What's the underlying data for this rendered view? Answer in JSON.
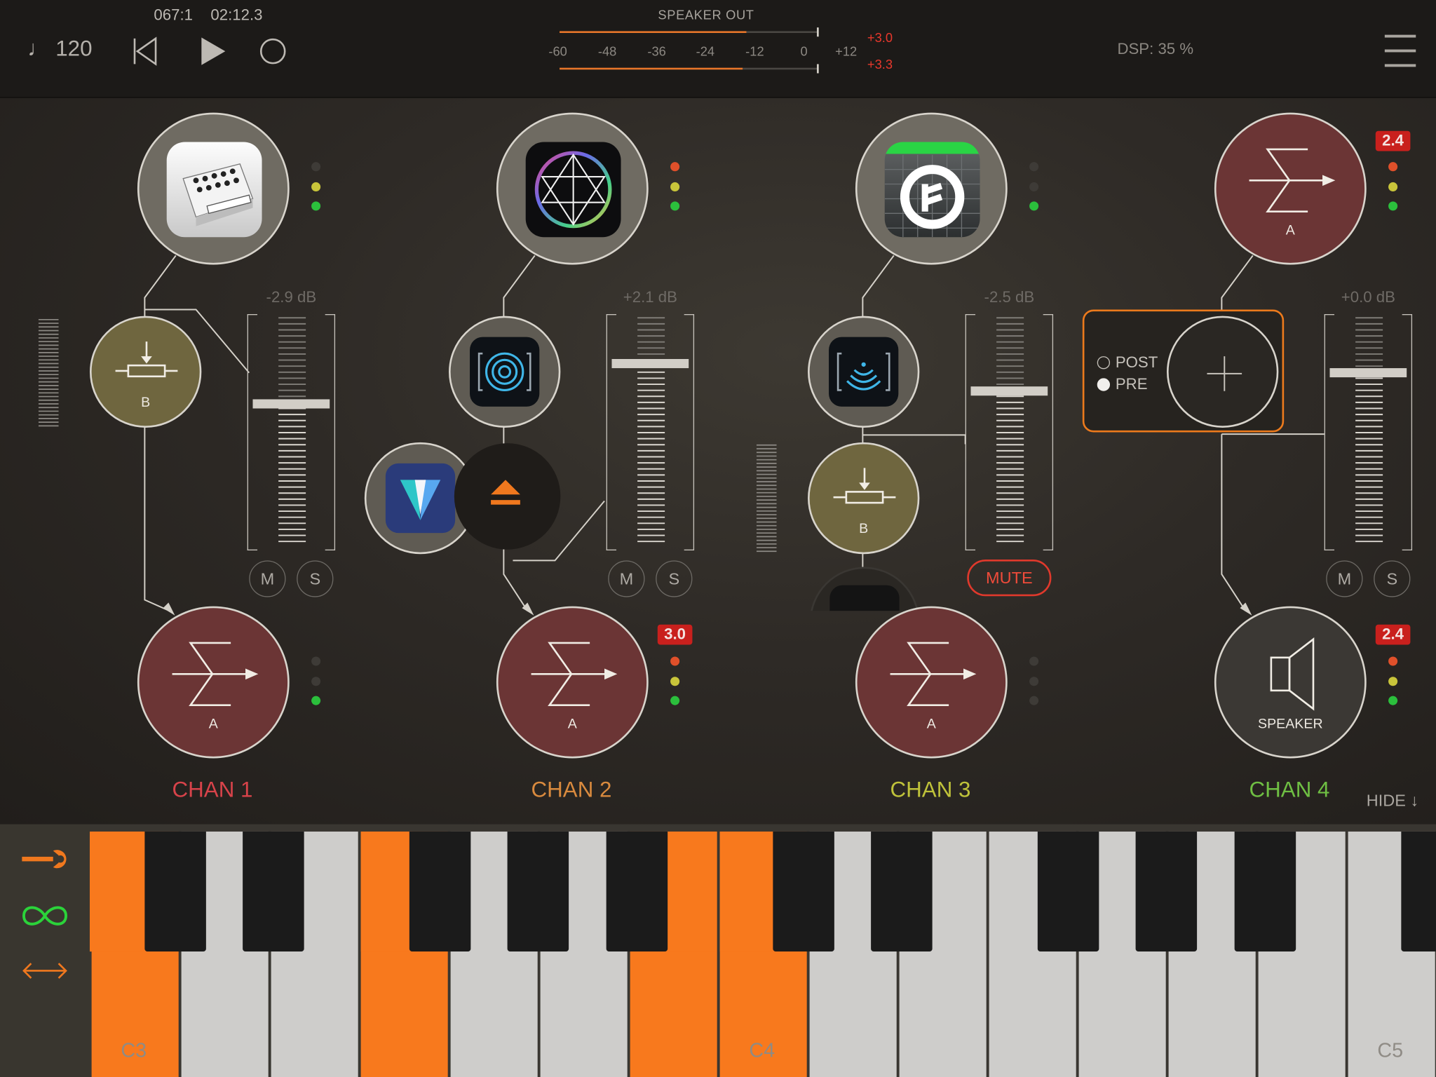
{
  "transport": {
    "bar_beat": "067:1",
    "time": "02:12.3",
    "tempo": "♩ 120"
  },
  "speaker_out": {
    "title": "SPEAKER OUT",
    "scale": [
      "-60",
      "-48",
      "-36",
      "-24",
      "-12",
      "0",
      "+12"
    ],
    "peak_top": "+3.0",
    "peak_bottom": "+3.3"
  },
  "dsp": "DSP: 35 %",
  "channels": [
    {
      "label": "CHAN 1",
      "color": "#d8434a",
      "db": "-2.9 dB",
      "generator": "synth-app-icon",
      "pot_label": "B",
      "sum_label": "A",
      "level": 0.62,
      "mute": "M",
      "solo": "S"
    },
    {
      "label": "CHAN 2",
      "color": "#d98a3e",
      "db": "+2.1 dB",
      "generator": "prism-app-icon",
      "fx_icon": "rings-app-icon",
      "extra_icon": "crystal-app-icon",
      "sum_label": "A",
      "badge": "3.0",
      "level": 0.8,
      "mute": "M",
      "solo": "S"
    },
    {
      "label": "CHAN 3",
      "color": "#bfc23a",
      "db": "-2.5 dB",
      "generator": "note-app-icon",
      "fx_icon": "waves-app-icon",
      "pot_label": "B",
      "sum_label": "A",
      "level": 0.68,
      "mute_label": "MUTE"
    },
    {
      "label": "CHAN 4",
      "color": "#6fbf43",
      "db": "+0.0 dB",
      "bus_label": "A",
      "badge_top": "2.4",
      "badge_bottom": "2.4",
      "output_label": "SPEAKER",
      "level": 0.76,
      "mute": "M",
      "solo": "S",
      "send_options": [
        "POST",
        "PRE"
      ],
      "send_selected": "PRE"
    }
  ],
  "hide_label": "HIDE ↓",
  "keyboard": {
    "labels": [
      "C3",
      "C4",
      "C5"
    ],
    "tools": [
      "wrench-icon",
      "infinity-icon",
      "double-arrow-icon"
    ],
    "accent": "#f8791d"
  }
}
